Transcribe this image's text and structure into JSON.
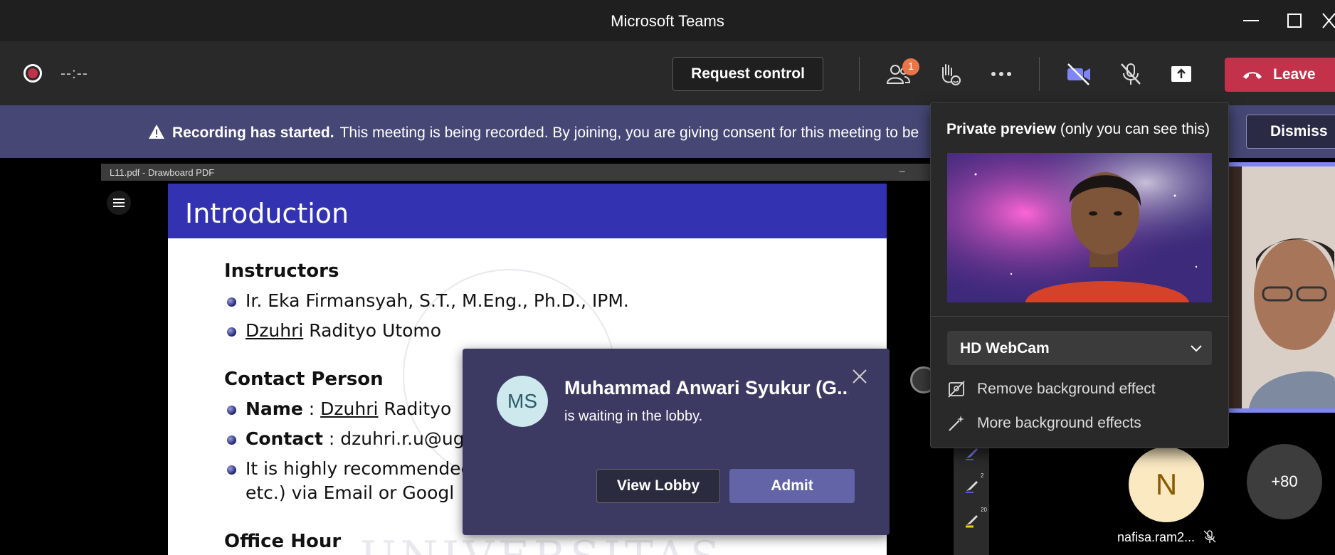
{
  "window": {
    "title": "Microsoft Teams"
  },
  "toolbar": {
    "timer": "--:--",
    "request_control_label": "Request control",
    "participants_badge": "1",
    "leave_label": "Leave"
  },
  "banner": {
    "heading": "Recording has started.",
    "message": "This meeting is being recorded. By joining, you are giving consent for this meeting to be recorded.",
    "dismiss_label": "Dismiss"
  },
  "share": {
    "window_title": "L11.pdf - Drawboard PDF",
    "window_minimize": "–"
  },
  "slide": {
    "title": "Introduction",
    "instructors_heading": "Instructors",
    "instructor_1": "Ir. Eka Firmansyah, S.T., M.Eng., Ph.D., IPM.",
    "instructor_2_first": "Dzuhri",
    "instructor_2_rest": " Radityo Utomo",
    "contact_heading": "Contact Person",
    "name_label": "Name",
    "name_sep": " : ",
    "name_first": "Dzuhri",
    "name_rest": " Radityo",
    "contact_label": "Contact",
    "contact_value": " : dzuhri.r.u@ug",
    "recommend_line1": "It is highly recommended",
    "recommend_line2": "etc.) via Email or Googl",
    "office_heading": "Office Hour",
    "watermark": "UNIVERSITAS"
  },
  "lobby": {
    "initials": "MS",
    "name": "Muhammad Anwari Syukur (G...",
    "message": "is waiting in the lobby.",
    "view_lobby_label": "View Lobby",
    "admit_label": "Admit"
  },
  "tools": {
    "pen_2_size": "2",
    "highlighter_size": "20"
  },
  "participants": {
    "n_initial": "N",
    "n_name": "nafisa.ram2...",
    "more_count": "+80"
  },
  "preview": {
    "title_bold": "Private preview",
    "title_rest": " (only you can see this)",
    "camera": "HD WebCam",
    "remove_bg": "Remove background effect",
    "more_bg": "More background effects"
  },
  "colors": {
    "brand": "#6264a7",
    "leave": "#c4314b",
    "banner": "#464775",
    "slide_header": "#3333b2",
    "badge": "#e97548"
  }
}
